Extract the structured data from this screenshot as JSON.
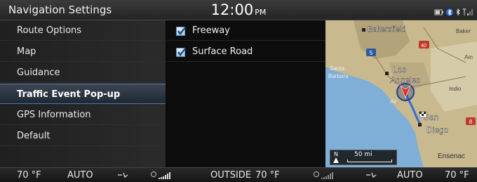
{
  "header": {
    "title": "Navigation Settings",
    "time": "12:00",
    "ampm": "PM"
  },
  "menu": {
    "items": [
      {
        "label": "Route Options",
        "active": false
      },
      {
        "label": "Map",
        "active": false
      },
      {
        "label": "Guidance",
        "active": false
      },
      {
        "label": "Traffic Event Pop-up",
        "active": true
      },
      {
        "label": "GPS Information",
        "active": false
      },
      {
        "label": "Default",
        "active": false
      }
    ]
  },
  "options": {
    "items": [
      {
        "label": "Freeway",
        "checked": true
      },
      {
        "label": "Surface Road",
        "checked": true
      }
    ]
  },
  "map": {
    "places": {
      "bakersfield": "Bakersfield",
      "baker": "Baker",
      "am": "Am",
      "santa_barbara_1": "Santa",
      "santa_barbara_2": "Barbara",
      "los_angeles_1": "Los",
      "los_angeles_2": "Angeles",
      "indio": "Indio",
      "av": "Av",
      "san_diego_1": "San",
      "san_diego_2": "Diego",
      "ensenada": "Ensenac"
    },
    "highways": {
      "h5": "5",
      "h40": "40",
      "h8": "8"
    },
    "scale": {
      "north": "N",
      "distance": "50 mi"
    }
  },
  "climate": {
    "left_temp": "70 °F",
    "left_mode": "AUTO",
    "outside_label": "OUTSIDE",
    "outside_temp": "70 °F",
    "right_mode": "AUTO",
    "right_temp": "70 °F"
  },
  "colors": {
    "accent": "#4e7aa6",
    "route": "#2f6fd6",
    "position_marker": "#e0312a"
  }
}
